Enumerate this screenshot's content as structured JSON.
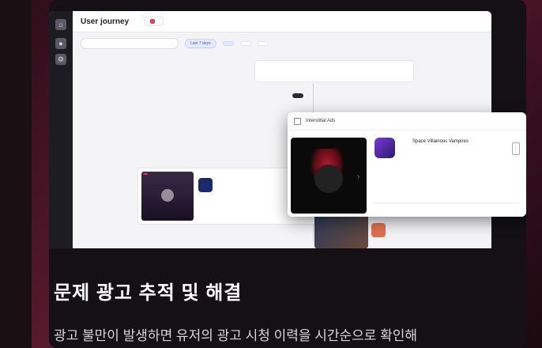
{
  "app": {
    "title": "User journey",
    "subtitle": "",
    "app_tag": "",
    "search_placeholder": "",
    "chips": [
      "Last 7 days",
      "",
      "",
      ""
    ],
    "summary_title": "",
    "summary_row": "",
    "pill_label": "",
    "rail": [
      {
        "icon": "home-icon",
        "label": ""
      },
      {
        "icon": "user-icon",
        "label": ""
      },
      {
        "icon": "settings-icon",
        "label": ""
      }
    ]
  },
  "event": {
    "header_left": "",
    "header_right": "",
    "badge": "",
    "title": "",
    "sub": "",
    "row": ""
  },
  "event2": {
    "header_left": "",
    "header_right": ""
  },
  "popup": {
    "title": "Interstitial Ads",
    "date": "",
    "game_title": "Space Villainous Vampires",
    "game_sub": "",
    "ad_clicked_label": "",
    "ad_clicked_value": "",
    "video_completed_label": "",
    "video_completed_value": "",
    "foot_a": "",
    "foot_b": ""
  },
  "hero": {
    "headline": "문제 광고 추적 및 해결",
    "description": "광고 불만이 발생하면 유저의 광고 시청 이력을 시간순으로 확인해",
    "watermark": ""
  },
  "colors": {
    "accent": "#e0405a",
    "panel": "#141014",
    "bg": "#5a1a2e"
  }
}
